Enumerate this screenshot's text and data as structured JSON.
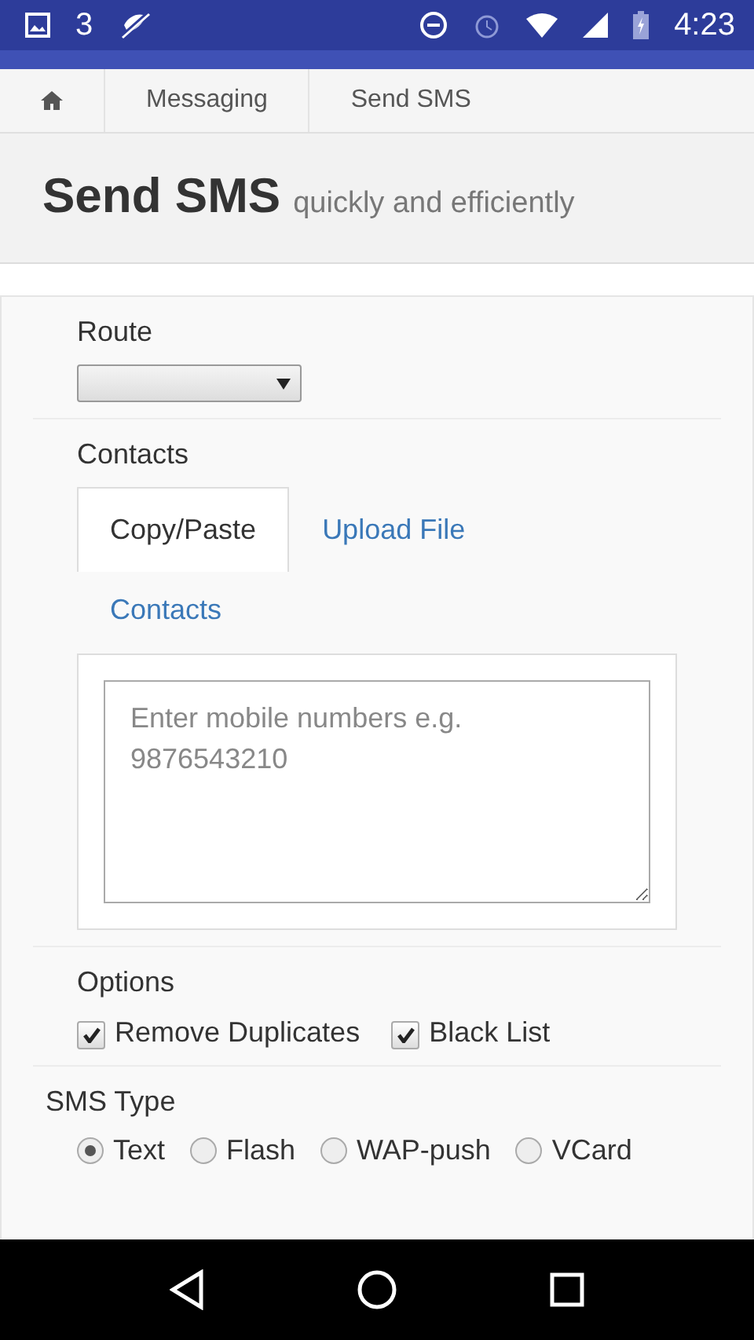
{
  "status_bar": {
    "notification_count": "3",
    "time": "4:23"
  },
  "breadcrumb": [
    "Messaging",
    "Send SMS"
  ],
  "page_header": {
    "title": "Send SMS",
    "subtitle": "quickly and efficiently"
  },
  "route": {
    "label": "Route"
  },
  "contacts": {
    "label": "Contacts",
    "tabs": [
      {
        "label": "Copy/Paste",
        "selected": true
      },
      {
        "label": "Upload File",
        "selected": false
      },
      {
        "label": "Contacts",
        "selected": false
      }
    ],
    "numbers_field": {
      "placeholder": "Enter mobile numbers e.g. 9876543210"
    }
  },
  "options": {
    "label": "Options",
    "items": [
      {
        "label": "Remove Duplicates",
        "checked": true
      },
      {
        "label": "Black List",
        "checked": true
      }
    ]
  },
  "sms_type": {
    "label": "SMS Type",
    "choices": [
      {
        "label": "Text",
        "selected": true
      },
      {
        "label": "Flash",
        "selected": false
      },
      {
        "label": "WAP-push",
        "selected": false
      },
      {
        "label": "VCard",
        "selected": false
      }
    ]
  }
}
